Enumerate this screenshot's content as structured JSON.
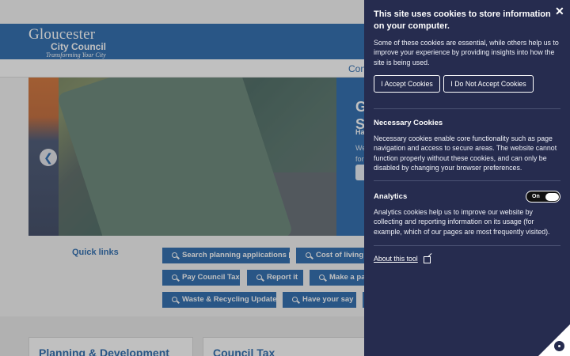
{
  "site": {
    "logo_line1": "Gloucester",
    "logo_line2": "City Council",
    "logo_line3": "Transforming Your City"
  },
  "nav": {
    "contact_partial": "Con"
  },
  "hero": {
    "title_partial": "G S",
    "sub_partial": "Ha",
    "body_partial": "We for"
  },
  "quick_links": {
    "title": "Quick links",
    "items": [
      {
        "label": "Search planning applications",
        "external": true
      },
      {
        "label": "Cost of living",
        "external": false
      },
      {
        "label": "Pay Council Tax",
        "external": false
      },
      {
        "label": "Report it",
        "external": false
      },
      {
        "label": "Make a pay",
        "external": false
      },
      {
        "label": "Waste & Recycling Updates",
        "external": false
      },
      {
        "label": "Have your say",
        "external": false
      }
    ]
  },
  "cards": [
    {
      "title": "Planning & Development"
    },
    {
      "title": "Council Tax"
    }
  ],
  "cookie": {
    "close": "✕",
    "title": "This site uses cookies to store information on your computer.",
    "intro": "Some of these cookies are essential, while others help us to improve your experience by providing insights into how the site is being used.",
    "accept": "I Accept Cookies",
    "reject": "I Do Not Accept Cookies",
    "necessary_title": "Necessary Cookies",
    "necessary_body": "Necessary cookies enable core functionality such as page navigation and access to secure areas. The website cannot function properly without these cookies, and can only be disabled by changing your browser preferences.",
    "analytics_title": "Analytics",
    "analytics_toggle": "On",
    "analytics_body": "Analytics cookies help us to improve our website by collecting and reporting information on its usage (for example, which of our pages are most frequently visited).",
    "about_link": "About this tool"
  },
  "colors": {
    "brand_blue": "#1b5fa8",
    "cookie_bg": "#262c4f"
  }
}
